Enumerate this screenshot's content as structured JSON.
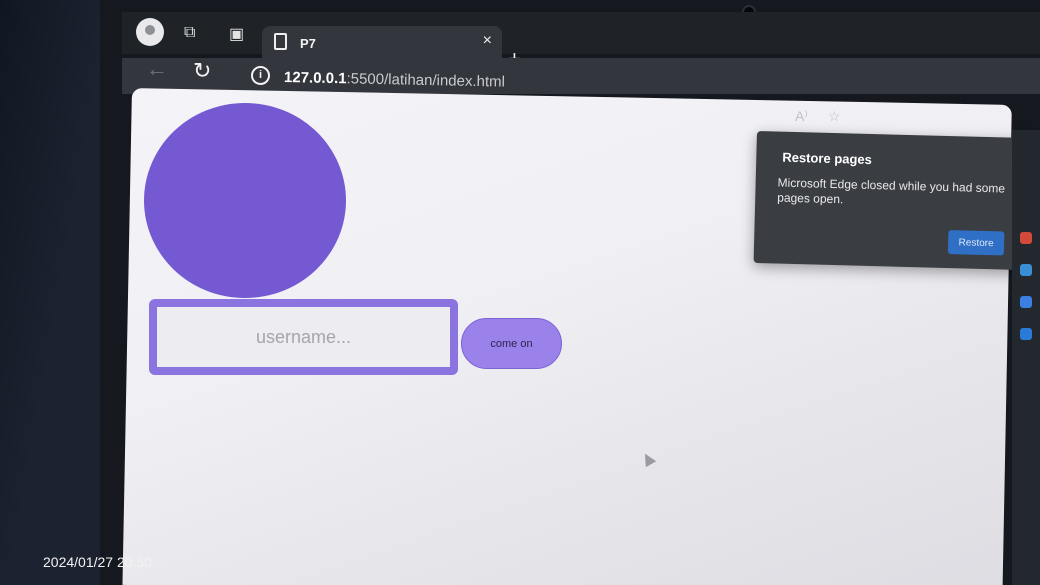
{
  "browser": {
    "tab_title": "P7",
    "tab_close": "×",
    "new_tab": "+",
    "url_host": "127.0.0.1",
    "url_rest": ":5500/latihan/index.html"
  },
  "page": {
    "username_placeholder": "username...",
    "button_label": "come on",
    "colors": {
      "circle": "#7559d2",
      "input_border": "#8b74e0",
      "button": "#9a82ea"
    }
  },
  "restore_popup": {
    "title": "Restore pages",
    "message": "Microsoft Edge closed while you had some pages open.",
    "button_label": "Restore"
  },
  "photo_timestamp": "2024/01/27 20:50"
}
